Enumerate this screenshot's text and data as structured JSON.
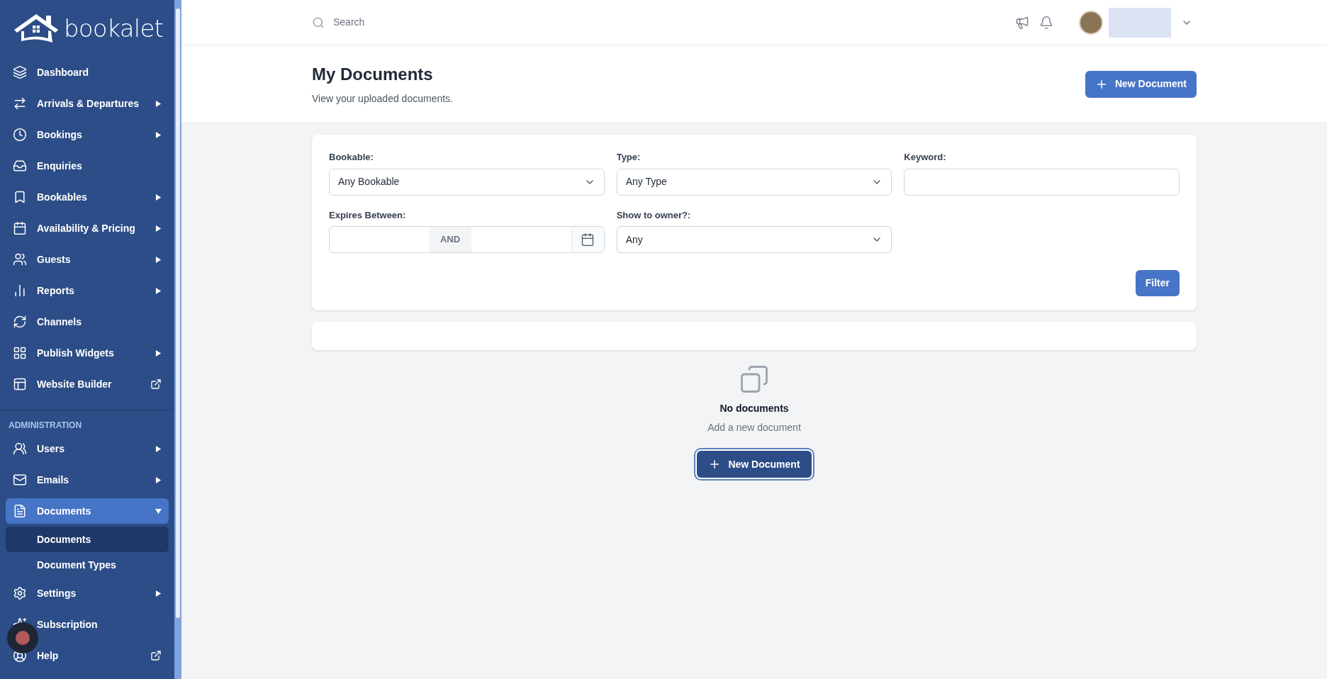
{
  "sidebar": {
    "logo": "bookalet",
    "items": [
      {
        "label": "Dashboard",
        "kind": "plain",
        "selected": false
      },
      {
        "label": "Arrivals & Departures",
        "kind": "submenu",
        "selected": false
      },
      {
        "label": "Bookings",
        "kind": "submenu",
        "selected": false
      },
      {
        "label": "Enquiries",
        "kind": "plain",
        "selected": false
      },
      {
        "label": "Bookables",
        "kind": "submenu",
        "selected": false
      },
      {
        "label": "Availability & Pricing",
        "kind": "submenu",
        "selected": false
      },
      {
        "label": "Guests",
        "kind": "submenu",
        "selected": false
      },
      {
        "label": "Reports",
        "kind": "submenu",
        "selected": false
      },
      {
        "label": "Channels",
        "kind": "plain",
        "selected": false
      },
      {
        "label": "Publish Widgets",
        "kind": "submenu",
        "selected": false
      },
      {
        "label": "Website Builder",
        "kind": "external",
        "selected": false
      }
    ],
    "section_title": "ADMINISTRATION",
    "admin_items": [
      {
        "label": "Users",
        "kind": "submenu",
        "selected": false,
        "expanded": false
      },
      {
        "label": "Emails",
        "kind": "submenu",
        "selected": false,
        "expanded": false
      },
      {
        "label": "Documents",
        "kind": "submenu",
        "selected": true,
        "expanded": true,
        "children": [
          {
            "label": "Documents",
            "selected": true
          },
          {
            "label": "Document Types",
            "selected": false
          }
        ]
      },
      {
        "label": "Settings",
        "kind": "submenu",
        "selected": false,
        "expanded": false
      },
      {
        "label": "Subscription",
        "kind": "plain",
        "selected": false
      },
      {
        "label": "Help",
        "kind": "external",
        "selected": false
      }
    ]
  },
  "header": {
    "search": {
      "placeholder": "Search"
    }
  },
  "page": {
    "title": "My Documents",
    "subtitle": "View your uploaded documents.",
    "new_button": "New Document"
  },
  "filters": {
    "fields": [
      {
        "label": "Bookable:",
        "kind": "select",
        "value": "Any Bookable"
      },
      {
        "label": "Type:",
        "kind": "select",
        "value": "Any Type"
      },
      {
        "label": "Keyword:",
        "kind": "text"
      },
      {
        "label": "Expires Between:",
        "kind": "daterange",
        "separator": "AND"
      },
      {
        "label": "Show to owner?:",
        "kind": "select",
        "value": "Any"
      }
    ],
    "button": "Filter"
  },
  "empty_state": {
    "title": "No documents",
    "message": "Add a new document",
    "button": "New Document"
  }
}
